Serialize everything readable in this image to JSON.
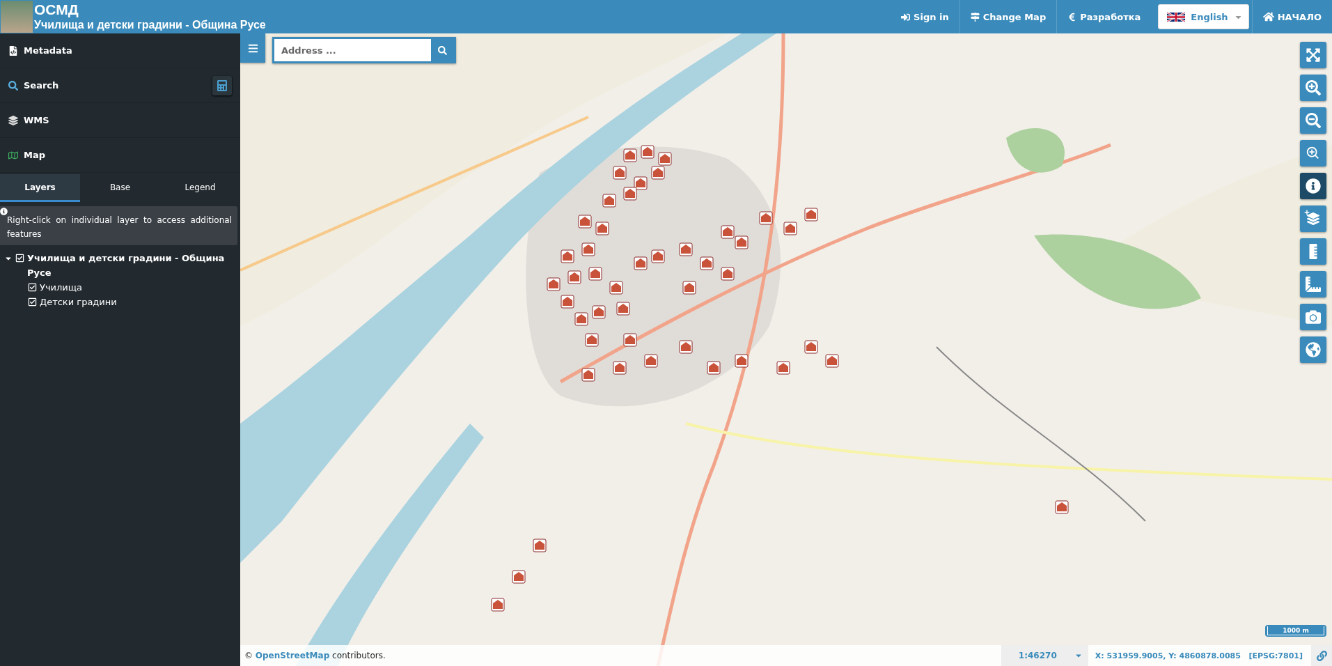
{
  "header": {
    "title": "ОСМД",
    "subtitle": "Училища и детски градини - Община Русе",
    "nav": [
      {
        "kind": "signin",
        "label": "Sign in"
      },
      {
        "kind": "changemap",
        "label": "Change Map"
      },
      {
        "kind": "euro",
        "label": "Разработка"
      }
    ],
    "language": {
      "label": "English"
    },
    "home": {
      "label": "НАЧАЛО"
    }
  },
  "sidebar": {
    "sections": [
      {
        "kind": "metadata",
        "label": "Metadata"
      },
      {
        "kind": "search",
        "label": "Search"
      },
      {
        "kind": "wms",
        "label": "WMS"
      },
      {
        "kind": "map",
        "label": "Map"
      }
    ],
    "tabs": [
      {
        "label": "Layers",
        "selected": true
      },
      {
        "label": "Base",
        "selected": false
      },
      {
        "label": "Legend",
        "selected": false
      }
    ],
    "note": "Right-click on individual layer to access additional features",
    "tree": [
      {
        "label": "Училища и детски градини - Община Русе",
        "checked": true,
        "expanded": true,
        "children": [
          {
            "label": "Училища",
            "checked": true
          },
          {
            "label": "Детски градини",
            "checked": true
          }
        ]
      }
    ]
  },
  "map": {
    "search": {
      "placeholder": "Address ..."
    },
    "tools": [
      {
        "kind": "fullscreen",
        "selected": false
      },
      {
        "kind": "zoom_in",
        "selected": false
      },
      {
        "kind": "zoom_out",
        "selected": false
      },
      {
        "kind": "zoom_box",
        "selected": false
      },
      {
        "kind": "info",
        "selected": true
      },
      {
        "kind": "add_layer",
        "selected": false
      },
      {
        "kind": "measure_length",
        "selected": false
      },
      {
        "kind": "measure_area",
        "selected": false
      },
      {
        "kind": "screenshot",
        "selected": false
      },
      {
        "kind": "print",
        "selected": false
      }
    ],
    "scale_line": "1000 m"
  },
  "status_bar": {
    "attribution_prefix": "©",
    "attribution_link": "OpenStreetMap",
    "attribution_suffix": "contributors.",
    "scale": "1:46270",
    "coordinates": "X: 531959.9005, Y: 4860878.0085",
    "projection": "[EPSG:7801]"
  }
}
